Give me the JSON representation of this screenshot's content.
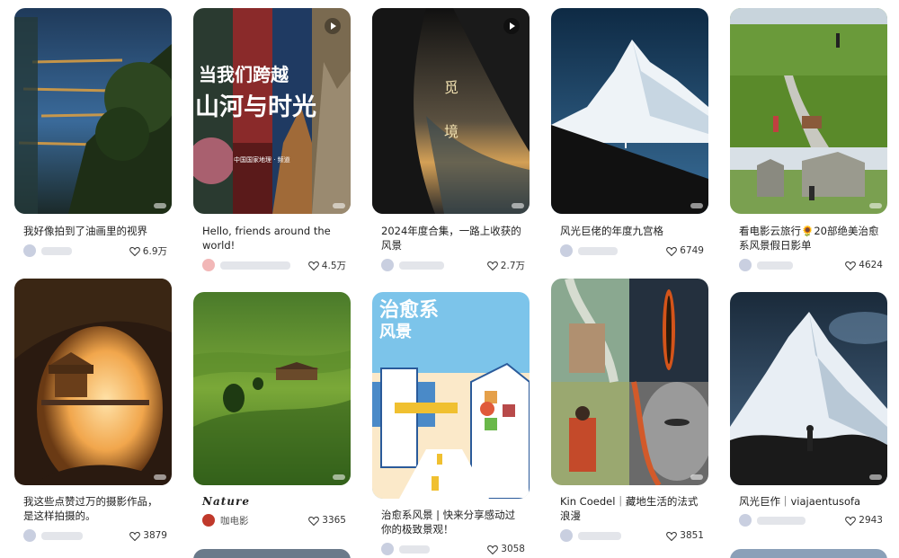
{
  "feed": {
    "col1": [
      {
        "title": "我好像拍到了油画里的视界",
        "likes": "6.9万"
      },
      {
        "title": "我这些点赞过万的摄影作品，是这样拍摄的。",
        "likes": "3879"
      }
    ],
    "col2": [
      {
        "title": "Hello, friends around the world!",
        "likes": "4.5万",
        "cover_text_1": "当我们跨越",
        "cover_text_2": "山河与时光",
        "cover_logo": "中国国家地理 · 频道"
      },
      {
        "title": "Nature",
        "author": "咖电影",
        "likes": "3365"
      }
    ],
    "col3": [
      {
        "title": "2024年度合集，一路上收获的风景",
        "likes": "2.7万",
        "cover_text": "觅 境"
      },
      {
        "title": "治愈系风景 | 快来分享感动过你的极致景观！",
        "likes": "3058",
        "cover_text_1": "治愈系",
        "cover_text_2": "风景"
      }
    ],
    "col4": [
      {
        "title": "风光巨佬的年度九宫格",
        "likes": "6749"
      },
      {
        "title": "Kin Coedel｜藏地生活的法式浪漫",
        "likes": "3851"
      }
    ],
    "col5": [
      {
        "title": "看电影云旅行🌻20部绝美治愈系风景假日影单",
        "likes": "4624"
      },
      {
        "title": "风光巨作｜viajaentusofa",
        "likes": "2943"
      }
    ]
  },
  "icons": {
    "like": "heart-outline-icon",
    "video": "play-icon"
  }
}
